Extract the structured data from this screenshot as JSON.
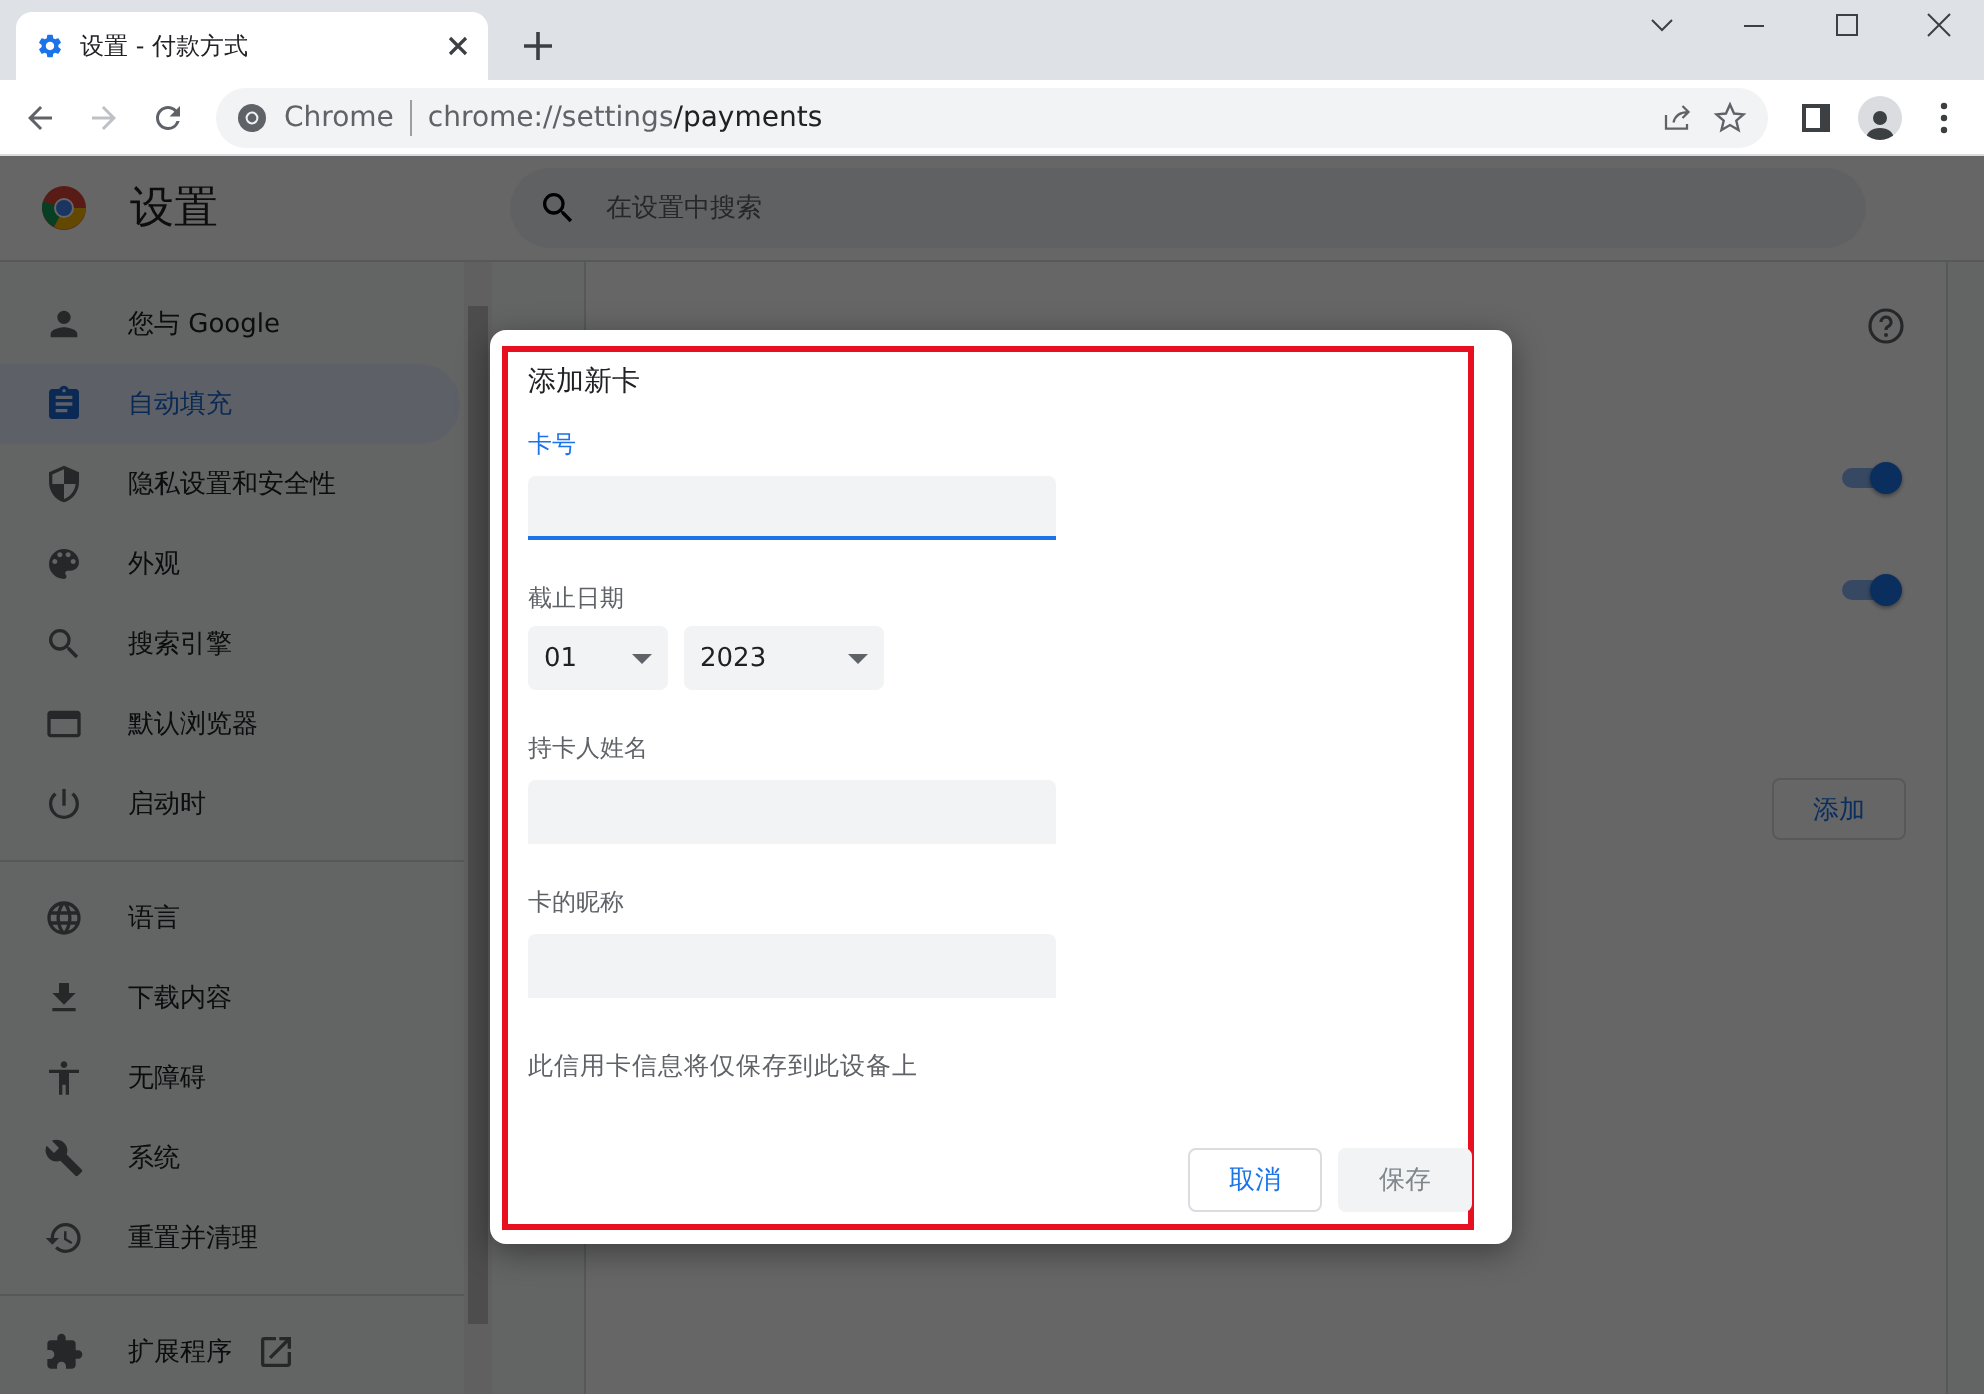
{
  "browser": {
    "tabs": [
      {
        "title": "设置 - 付款方式",
        "selected": true
      }
    ],
    "address": {
      "site": "Chrome",
      "url_host": "chrome://settings",
      "url_path": "/payments"
    }
  },
  "settings": {
    "title": "设置",
    "search": {
      "placeholder": "在设置中搜索"
    }
  },
  "sidebar": {
    "groups": [
      [
        {
          "label": "您与 Google",
          "selected": false
        },
        {
          "label": "自动填充",
          "selected": true
        },
        {
          "label": "隐私设置和安全性",
          "selected": false
        },
        {
          "label": "外观",
          "selected": false
        },
        {
          "label": "搜索引擎",
          "selected": false
        },
        {
          "label": "默认浏览器",
          "selected": false
        },
        {
          "label": "启动时",
          "selected": false
        }
      ],
      [
        {
          "label": "语言",
          "selected": false
        },
        {
          "label": "下载内容",
          "selected": false
        },
        {
          "label": "无障碍",
          "selected": false
        },
        {
          "label": "系统",
          "selected": false
        },
        {
          "label": "重置并清理",
          "selected": false
        }
      ],
      [
        {
          "label": "扩展程序",
          "selected": false,
          "external": true
        }
      ]
    ]
  },
  "main": {
    "toggles": [
      {
        "on": true
      },
      {
        "on": true
      }
    ],
    "add_button": "添加"
  },
  "dialog": {
    "title": "添加新卡",
    "fields": [
      {
        "kind": "text",
        "label": "卡号",
        "focused": true
      },
      {
        "kind": "date",
        "label": "截止日期",
        "month": "01",
        "year": "2023"
      },
      {
        "kind": "text",
        "label": "持卡人姓名",
        "focused": false
      },
      {
        "kind": "text",
        "label": "卡的昵称",
        "focused": false
      }
    ],
    "note": "此信用卡信息将仅保存到此设备上",
    "buttons": [
      {
        "label": "取消",
        "kind": "secondary",
        "disabled": false
      },
      {
        "label": "保存",
        "kind": "primary",
        "disabled": true
      }
    ]
  }
}
